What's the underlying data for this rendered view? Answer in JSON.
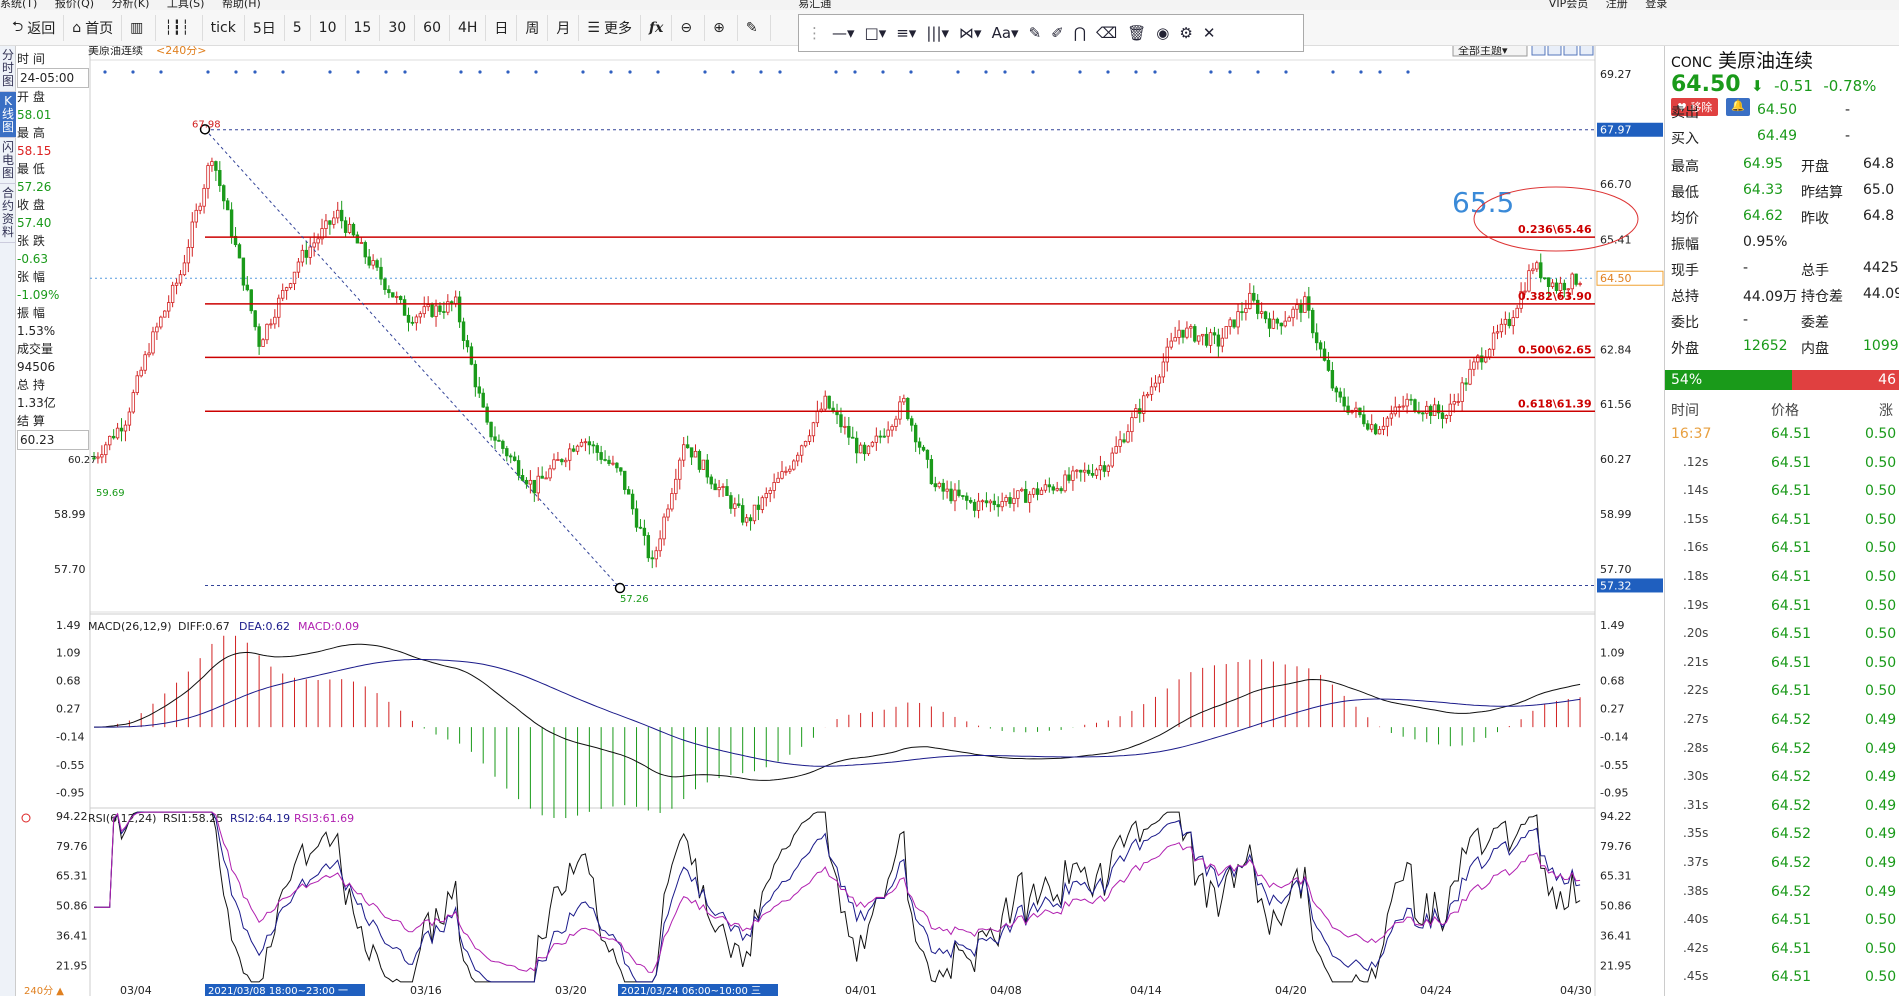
{
  "menubar": [
    "系统(T)",
    "报价(Q)",
    "分析(K)",
    "工具(S)",
    "帮助(H)",
    "易汇通",
    "VIP会员",
    "注册",
    "登录"
  ],
  "toolbar": {
    "back": "返回",
    "home": "首页",
    "tick": "tick",
    "periods": [
      "5日",
      "5",
      "10",
      "15",
      "30",
      "60",
      "4H",
      "日",
      "周",
      "月"
    ],
    "more": "更多",
    "fx": "fx"
  },
  "drawbar": {
    "items": [
      "—▾",
      "□▾",
      "≡▾",
      "|||▾",
      "⋈▾",
      "Aa▾",
      "✎",
      "✐",
      "⋂",
      "⌫",
      "🗑",
      "◉",
      "⚙",
      "✕"
    ]
  },
  "leftbar": [
    "分时图",
    "K线图",
    "闪电图",
    "合约资料"
  ],
  "infopanel": {
    "time_label": "时 间",
    "time": "24-05:00",
    "open_label": "开 盘",
    "open": "58.01",
    "high_label": "最 高",
    "high": "58.15",
    "low_label": "最 低",
    "low": "57.26",
    "close_label": "收 盘",
    "close": "57.40",
    "chg_label": "张 跌",
    "chg": "-0.63",
    "chgpct_label": "张 幅",
    "chgpct": "-1.09%",
    "amp_label": "振 幅",
    "amp": "1.53%",
    "vol_label": "成交量",
    "vol": "94506",
    "hold_label": "总 持",
    "hold": "1.33亿",
    "settle_label": "结 算",
    "settle": "60.23"
  },
  "chart": {
    "title": "美原油连续",
    "period": "<240分>",
    "theme_btn": "全部主题▾",
    "price_axis": [
      "69.27",
      "67.97",
      "66.70",
      "65.41",
      "64.50",
      "62.84",
      "61.56",
      "60.27",
      "58.99",
      "57.70",
      "57.32"
    ],
    "high_marker": "67.98",
    "low_marker": "57.26",
    "left_low": "59.69",
    "left_axis_partial": "60.27",
    "annotation_big": "65.5",
    "fib_levels": [
      "0.236\\65.46",
      "0.382\\63.90",
      "0.500\\62.65",
      "0.618\\61.39"
    ],
    "macd_label": "MACD(26,12,9)",
    "macd_diff": "DIFF:0.67",
    "macd_dea": "DEA:0.62",
    "macd_val": "MACD:0.09",
    "macd_axis": [
      "1.49",
      "1.09",
      "0.68",
      "0.27",
      "-0.14",
      "-0.55",
      "-0.95"
    ],
    "rsi_label": "RSI(6,12,24)",
    "rsi1": "RSI1:58.25",
    "rsi2": "RSI2:64.19",
    "rsi3": "RSI3:61.69",
    "rsi_axis": [
      "94.22",
      "79.76",
      "65.31",
      "50.86",
      "36.41",
      "21.95"
    ],
    "dates": [
      "03/04",
      "03/16",
      "03/20",
      "04/01",
      "04/08",
      "04/14",
      "04/20",
      "04/24",
      "04/30"
    ],
    "date_hl1": "2021/03/08 18:00~23:00 一",
    "date_hl2": "2021/03/24 06:00~10:00 三",
    "period_tag": "240分 ▲"
  },
  "quote": {
    "code": "CONC",
    "name": "美原油连续",
    "price": "64.50",
    "arrow": "⬇",
    "change": "-0.51",
    "change_pct": "-0.78%",
    "del_btn": "♥ 移除",
    "bell_btn": "🔔",
    "sell_label": "卖出",
    "sell": "64.50",
    "sell_vol": "-",
    "buy_label": "买入",
    "buy": "64.49",
    "buy_vol": "-",
    "rows": [
      [
        "最高",
        "64.95",
        "开盘",
        "64.8"
      ],
      [
        "最低",
        "64.33",
        "昨结算",
        "65.0"
      ],
      [
        "均价",
        "64.62",
        "昨收",
        "64.8"
      ],
      [
        "振幅",
        "0.95%",
        "",
        ""
      ],
      [
        "现手",
        "-",
        "总手",
        "4425"
      ],
      [
        "总持",
        "44.09万",
        "持仓差",
        "44.09"
      ],
      [
        "委比",
        "-",
        "委差",
        ""
      ],
      [
        "外盘",
        "12652",
        "内盘",
        "1099"
      ]
    ],
    "buy_pct": "54%",
    "sell_pct": "46",
    "tick_headers": [
      "时间",
      "价格",
      "涨"
    ],
    "ticks": [
      [
        "16:37",
        "64.51",
        "0.50"
      ],
      [
        ".12s",
        "64.51",
        "0.50"
      ],
      [
        ".14s",
        "64.51",
        "0.50"
      ],
      [
        ".15s",
        "64.51",
        "0.50"
      ],
      [
        ".16s",
        "64.51",
        "0.50"
      ],
      [
        ".18s",
        "64.51",
        "0.50"
      ],
      [
        ".19s",
        "64.51",
        "0.50"
      ],
      [
        ".20s",
        "64.51",
        "0.50"
      ],
      [
        ".21s",
        "64.51",
        "0.50"
      ],
      [
        ".22s",
        "64.51",
        "0.50"
      ],
      [
        ".27s",
        "64.52",
        "0.49"
      ],
      [
        ".28s",
        "64.52",
        "0.49"
      ],
      [
        ".30s",
        "64.52",
        "0.49"
      ],
      [
        ".31s",
        "64.52",
        "0.49"
      ],
      [
        ".35s",
        "64.52",
        "0.49"
      ],
      [
        ".37s",
        "64.52",
        "0.49"
      ],
      [
        ".38s",
        "64.52",
        "0.49"
      ],
      [
        ".40s",
        "64.51",
        "0.50"
      ],
      [
        ".42s",
        "64.51",
        "0.50"
      ],
      [
        ".45s",
        "64.51",
        "0.50"
      ]
    ]
  },
  "colors": {
    "up": "#d22222",
    "down": "#1a9a1a",
    "macd1": "#111111",
    "macd2": "#1a1a8a",
    "rsi3": "#b020b0",
    "fib": "#cc0000"
  }
}
